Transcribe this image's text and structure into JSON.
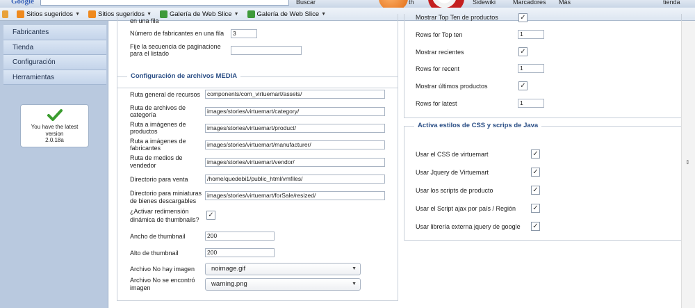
{
  "chrome": {
    "google": "Google",
    "buscar": "Buscar",
    "sidewiki": "Sidewiki",
    "marcadores": "Marcadores",
    "mas": "Más",
    "tienda": "tienda",
    "partial_th": "th"
  },
  "favorites": [
    {
      "label": "Sitios sugeridos",
      "icon": "suggested-sites-icon",
      "color": "#ef8a1f"
    },
    {
      "label": "Sitios sugeridos",
      "icon": "suggested-sites-icon",
      "color": "#ef8a1f"
    },
    {
      "label": "Galería de Web Slice",
      "icon": "web-slice-icon",
      "color": "#3f9a3a"
    },
    {
      "label": "Galería de Web Slice",
      "icon": "web-slice-icon",
      "color": "#3f9a3a"
    }
  ],
  "sidebar": {
    "items": [
      "Fabricantes",
      "Tienda",
      "Configuración",
      "Herramientas"
    ],
    "version": {
      "line1": "You have the latest",
      "line2": "version",
      "line3": "2.0.18a"
    }
  },
  "top_panel": {
    "partial_label": "en una fila",
    "row_label": "Número de fabricantes en una fila",
    "row_value": "3",
    "pagination_label_1": "Fije la secuencia de paginacione",
    "pagination_label_2": "para el listado",
    "pagination_value": ""
  },
  "media": {
    "legend": "Configuración de archivos MEDIA",
    "rows": [
      {
        "label1": "Ruta general de recursos",
        "label2": "",
        "value": "components/com_virtuemart/assets/"
      },
      {
        "label1": "Ruta de archivos de",
        "label2": "categoría",
        "value": "images/stories/virtuemart/category/"
      },
      {
        "label1": "Ruta a imágenes de",
        "label2": "productos",
        "value": "images/stories/virtuemart/product/"
      },
      {
        "label1": "Ruta a imágenes de",
        "label2": "fabricantes",
        "value": "images/stories/virtuemart/manufacturer/"
      },
      {
        "label1": "Ruta de medios de",
        "label2": "vendedor",
        "value": "images/stories/virtuemart/vendor/"
      },
      {
        "label1": "Directorio para venta",
        "label2": "",
        "value": "/home/quedebi1/public_html/vmfiles/"
      },
      {
        "label1": "Directorio para miniaturas",
        "label2": "de bienes descargables",
        "value": "images/stories/virtuemart/forSale/resized/"
      }
    ],
    "resize_label_1": "¿Activar redimensión",
    "resize_label_2": "dinámica de thumbnails?",
    "resize_checked": "✓",
    "thumb_width_label": "Ancho de thumbnail",
    "thumb_width_value": "200",
    "thumb_height_label": "Alto de thumbnail",
    "thumb_height_value": "200",
    "noimage_label": "Archivo No hay imagen",
    "noimage_value": "noimage.gif",
    "notfound_label_1": "Archivo No se encontró",
    "notfound_label_2": "imagen",
    "notfound_value": "warning.png"
  },
  "right_top": {
    "rows": [
      {
        "label": "Mostrar Top Ten de productos",
        "type": "check",
        "value": "✓"
      },
      {
        "label": "Rows for Top ten",
        "type": "text",
        "value": "1"
      },
      {
        "label": "Mostrar recientes",
        "type": "check",
        "value": "✓"
      },
      {
        "label": "Rows for recent",
        "type": "text",
        "value": "1"
      },
      {
        "label": "Mostrar últimos productos",
        "type": "check",
        "value": "✓"
      },
      {
        "label": "Rows for latest",
        "type": "text",
        "value": "1"
      }
    ]
  },
  "css_panel": {
    "legend": "Activa estilos de CSS y scrips de Java",
    "rows": [
      {
        "label": "Usar el CSS de virtuemart",
        "value": "✓"
      },
      {
        "label": "Usar Jquery de Virtuemart",
        "value": "✓"
      },
      {
        "label": "Usar los scripts de producto",
        "value": "✓"
      },
      {
        "label": "Usar el Script ajax por país / Región",
        "value": "✓"
      },
      {
        "label": "Usar librería externa jquery de google",
        "value": "✓"
      }
    ]
  }
}
